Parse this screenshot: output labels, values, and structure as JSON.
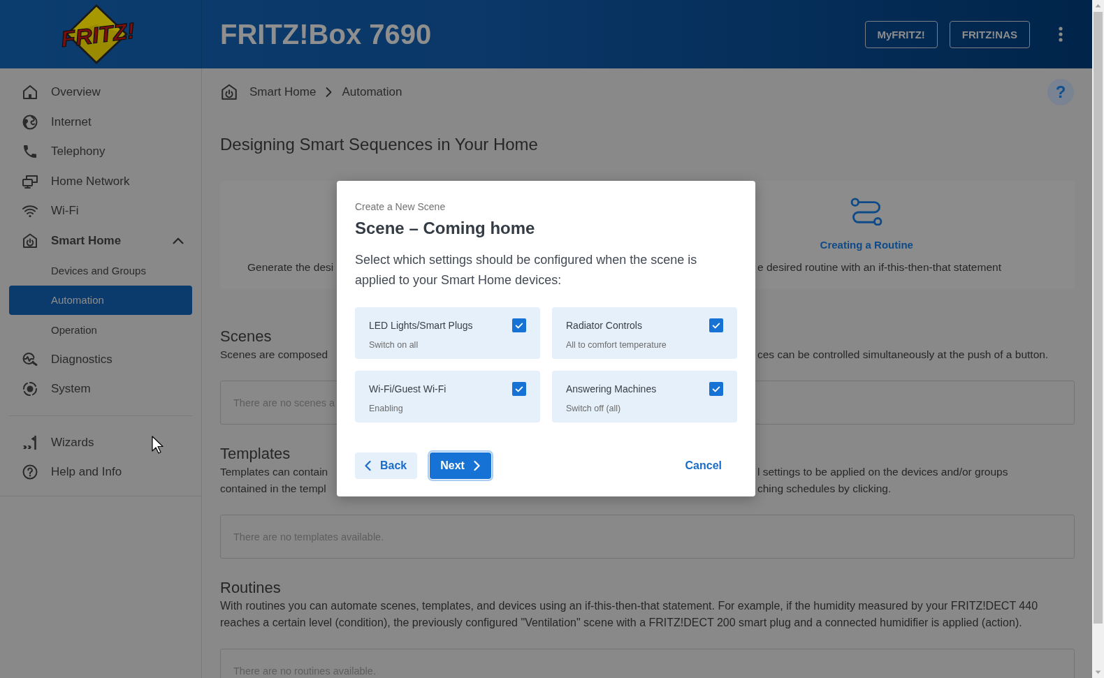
{
  "header": {
    "logo_text": "FRITZ!",
    "title": "FRITZ!Box 7690",
    "buttons": [
      "MyFRITZ!",
      "FRITZ!NAS"
    ]
  },
  "sidebar": {
    "items": [
      {
        "label": "Overview",
        "selected": false
      },
      {
        "label": "Internet",
        "selected": false
      },
      {
        "label": "Telephony",
        "selected": false
      },
      {
        "label": "Home Network",
        "selected": false
      },
      {
        "label": "Wi-Fi",
        "selected": false
      },
      {
        "label": "Smart Home",
        "selected": true,
        "expanded": true,
        "children": [
          {
            "label": "Devices and Groups",
            "selected": false
          },
          {
            "label": "Automation",
            "selected": true
          },
          {
            "label": "Operation",
            "selected": false
          }
        ]
      },
      {
        "label": "Diagnostics",
        "selected": false
      },
      {
        "label": "System",
        "selected": false
      }
    ],
    "secondary_items": [
      {
        "label": "Wizards",
        "selected": false
      },
      {
        "label": "Help and Info",
        "selected": false
      }
    ]
  },
  "breadcrumb": [
    "Smart Home",
    "Automation"
  ],
  "help_button": "?",
  "page": {
    "title": "Designing Smart Sequences in Your Home",
    "info_card": {
      "title": "Creating a Routine",
      "text_left": "Generate the desi",
      "text_right": "e desired routine with an if-this-then-that statement"
    },
    "sections": [
      {
        "heading": "Scenes",
        "lines": [
          {
            "left": "Scenes are composed",
            "right": "ces can be controlled simultaneously at the push of a button."
          }
        ],
        "empty_text": "There are no scenes a"
      },
      {
        "heading": "Templates",
        "lines": [
          {
            "left": "Templates can contain",
            "right": "l settings to be applied on the devices and/or groups"
          },
          {
            "left": "contained in the templ",
            "right": "ching schedules by clicking."
          }
        ],
        "empty_text": "There are no templates available."
      },
      {
        "heading": "Routines",
        "text": "With routines you can automate scenes, templates, and devices using an if-this-then-that statement. For example, if the humidity measured by your FRITZ!DECT 440 reaches a certain level (condition), the previously configured \"Ventilation\" scene with a FRITZ!DECT 200 smart plug and a connected humidifier is applied (action).",
        "empty_text": "There are no routines available."
      }
    ]
  },
  "dialog": {
    "overline": "Create a New Scene",
    "title": "Scene – Coming home",
    "description": "Select which settings should be configured when the scene is applied to your Smart Home devices:",
    "options": [
      {
        "title": "LED Lights/Smart Plugs",
        "subtitle": "Switch on all",
        "checked": true
      },
      {
        "title": "Radiator Controls",
        "subtitle": "All to comfort temperature",
        "checked": true
      },
      {
        "title": "Wi-Fi/Guest Wi-Fi",
        "subtitle": "Enabling",
        "checked": true
      },
      {
        "title": "Answering Machines",
        "subtitle": "Switch off (all)",
        "checked": true
      }
    ],
    "buttons": [
      {
        "label": "Back",
        "kind": "secondary",
        "focused": false
      },
      {
        "label": "Next",
        "kind": "primary",
        "focused": true
      },
      {
        "label": "Cancel",
        "kind": "link",
        "focused": false
      }
    ]
  }
}
